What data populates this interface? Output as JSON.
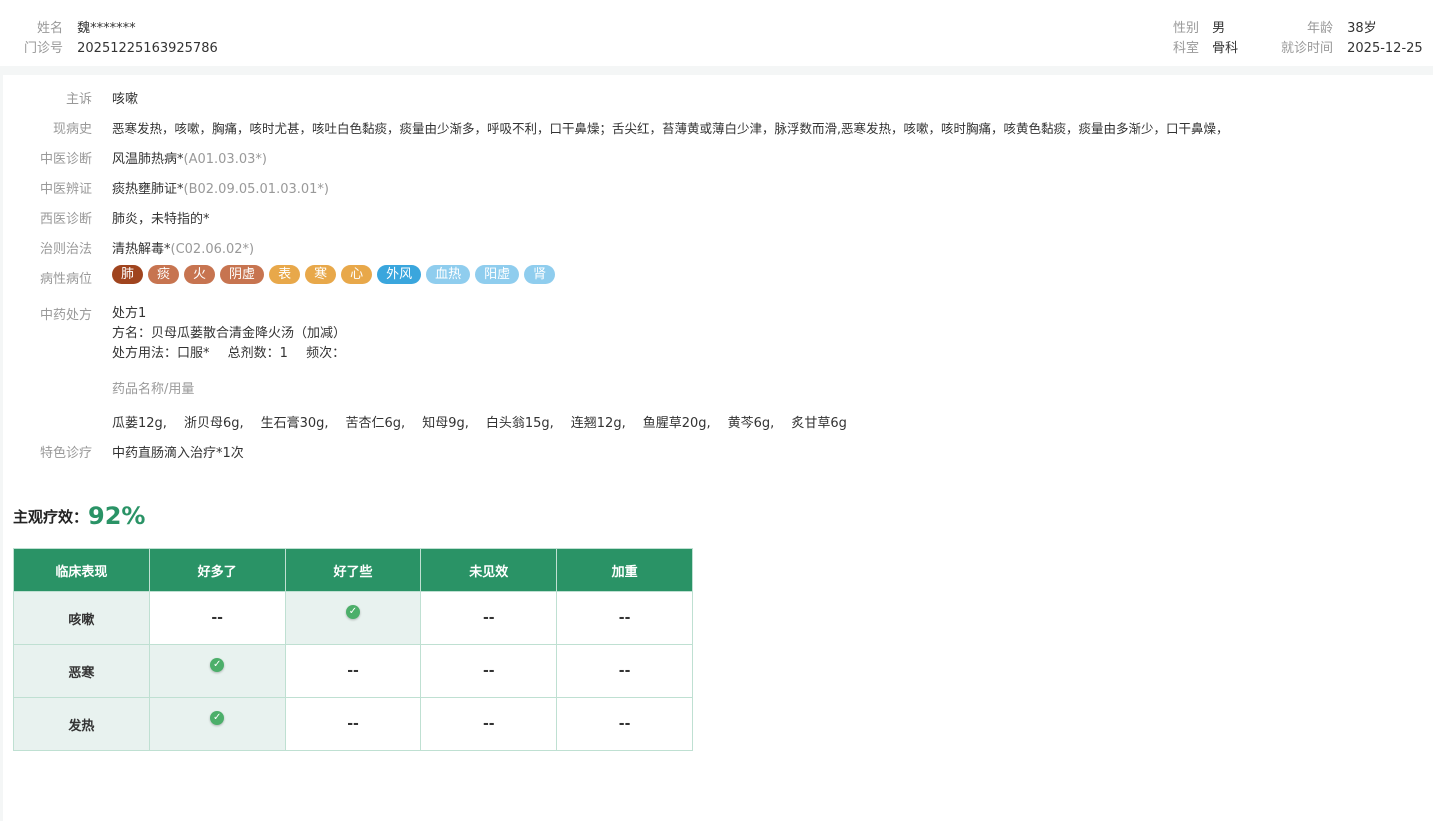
{
  "header": {
    "name_label": "姓名",
    "name_value": "魏*******",
    "id_label": "门诊号",
    "id_value": "20251225163925786",
    "gender_label": "性别",
    "gender_value": "男",
    "age_label": "年龄",
    "age_value": "38岁",
    "dept_label": "科室",
    "dept_value": "骨科",
    "date_label": "就诊时间",
    "date_value": "2025-12-25"
  },
  "record": {
    "complaint": {
      "label": "主诉",
      "value": "咳嗽"
    },
    "history": {
      "label": "现病史",
      "value": "恶寒发热，咳嗽，胸痛，咳时尤甚，咳吐白色黏痰，痰量由少渐多，呼吸不利，口干鼻燥；舌尖红，苔薄黄或薄白少津，脉浮数而滑,恶寒发热，咳嗽，咳时胸痛，咳黄色黏痰，痰量由多渐少，口干鼻燥，"
    },
    "tcm_diag": {
      "label": "中医诊断",
      "value": "风温肺热病*",
      "code": "(A01.03.03*)"
    },
    "tcm_syndrome": {
      "label": "中医辨证",
      "value": "痰热壅肺证*",
      "code": "(B02.09.05.01.03.01*)"
    },
    "west_diag": {
      "label": "西医诊断",
      "value": "肺炎，未特指的*"
    },
    "treatment": {
      "label": "治则治法",
      "value": "清热解毒*",
      "code": "(C02.06.02*)"
    },
    "pathology": {
      "label": "病性病位",
      "tags": [
        {
          "text": "肺",
          "color": "#a0441e"
        },
        {
          "text": "痰",
          "color": "#c77450"
        },
        {
          "text": "火",
          "color": "#c77450"
        },
        {
          "text": "阴虚",
          "color": "#c77450"
        },
        {
          "text": "表",
          "color": "#e8a84a"
        },
        {
          "text": "寒",
          "color": "#e8a84a"
        },
        {
          "text": "心",
          "color": "#e8a84a"
        },
        {
          "text": "外风",
          "color": "#3aa6dd"
        },
        {
          "text": "血热",
          "color": "#8fcdee"
        },
        {
          "text": "阳虚",
          "color": "#8fcdee"
        },
        {
          "text": "肾",
          "color": "#8fcdee"
        }
      ]
    },
    "prescription": {
      "label": "中药处方",
      "title": "处方1",
      "name": "方名：贝母瓜蒌散合清金降火汤（加减）",
      "usage": "处方用法：口服*",
      "total": "总剂数：1",
      "freq": "频次：",
      "drug_header": "药品名称/用量",
      "herbs": [
        "瓜蒌12g,",
        "浙贝母6g,",
        "生石膏30g,",
        "苦杏仁6g,",
        "知母9g,",
        "白头翁15g,",
        "连翘12g,",
        "鱼腥草20g,",
        "黄芩6g,",
        "炙甘草6g"
      ]
    },
    "special": {
      "label": "特色诊疗",
      "value": "中药直肠滴入治疗*1次"
    }
  },
  "efficacy": {
    "title": "主观疗效：",
    "percent": "92%",
    "headers": [
      "临床表现",
      "好多了",
      "好了些",
      "未见效",
      "加重"
    ],
    "rows": [
      {
        "name": "咳嗽",
        "cells": [
          "--",
          "check",
          "--",
          "--"
        ]
      },
      {
        "name": "恶寒",
        "cells": [
          "check",
          "--",
          "--",
          "--"
        ]
      },
      {
        "name": "发热",
        "cells": [
          "check",
          "--",
          "--",
          "--"
        ]
      }
    ]
  }
}
